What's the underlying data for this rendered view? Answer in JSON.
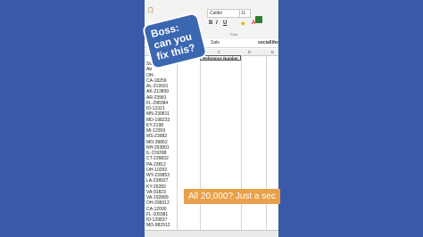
{
  "ribbon": {
    "font_name": "Calibri",
    "font_size": "11",
    "bold": "B",
    "italic": "I",
    "underline": "U",
    "font_group": "Font"
  },
  "formula_bar": {
    "cell_ref": "",
    "formula": "fx",
    "sale_label": "Sale",
    "right_text": "sociallifeofexcel"
  },
  "columns": [
    "A",
    "B",
    "C",
    "D",
    "E"
  ],
  "ref_header": "Reference Number",
  "rows": [
    "Sta",
    "Ab",
    "OH-",
    "CA-18259",
    "AL-219931",
    "AK-213899",
    "AR-23981",
    "FL-298384",
    "ID-12321",
    "MN-239811",
    "MD-198233",
    "KY-2198",
    "MI-12359",
    "MS-23982",
    "MO-39862",
    "NH-293801",
    "IL-219398",
    "CT-239832",
    "PA-23812",
    "OH-10293",
    "WY-239853",
    "LA-238927",
    "KY-29283",
    "VA-91823",
    "VA-192889",
    "OH-298312",
    "CA-12090",
    "FL-109381",
    "ID-129837",
    "MO-982912"
  ],
  "callout_text": [
    "Boss:",
    "can you",
    "fix this?"
  ],
  "caption_text": "All 20,000? Just a sec"
}
